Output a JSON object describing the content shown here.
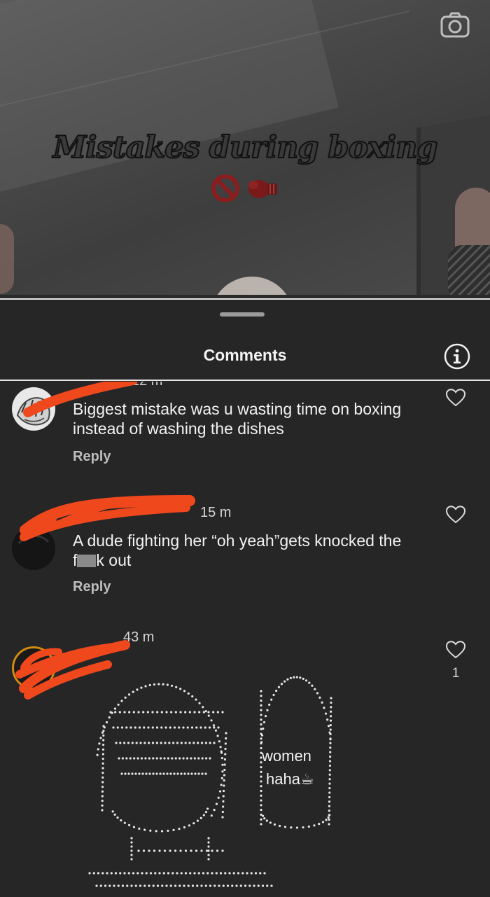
{
  "video": {
    "overlay_title": "Mistakes during boxing",
    "overlay_emojis": [
      "🚫",
      "🥊"
    ],
    "camera_icon": "camera-icon"
  },
  "sheet": {
    "title": "Comments",
    "info_icon": "info-icon"
  },
  "comments": [
    {
      "time": "12 m",
      "text": "Biggest mistake was u wasting time on boxing instead of washing the dishes",
      "reply_label": "Reply",
      "likes": ""
    },
    {
      "time": "15 m",
      "text_line1": "A dude fighting her “oh yeah”gets knocked the",
      "text_line2_start": "f",
      "text_line2_end": "k out",
      "reply_label": "Reply",
      "likes": ""
    },
    {
      "time": "43 m",
      "art_line1": "women",
      "art_line2": "haha☕",
      "likes": "1"
    }
  ],
  "colors": {
    "background": "#262626",
    "scribble": "#f0481d",
    "divider": "#e9e9e9"
  }
}
